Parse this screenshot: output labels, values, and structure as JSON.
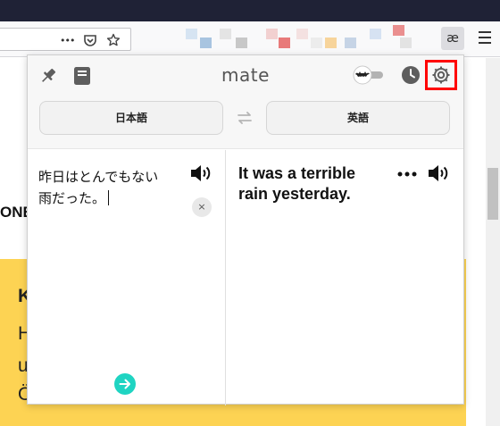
{
  "browser": {
    "more_glyph": "•••",
    "extension_label": "æ"
  },
  "background_page": {
    "bold_fragment": "ONE",
    "yellow_letters": [
      "K",
      "H",
      "u",
      "Ö"
    ],
    "yellow_color": "#fdd353"
  },
  "popup": {
    "brand": "mate",
    "icons": [
      "pin-icon",
      "phrasebook-icon",
      "bat-toggle-icon",
      "history-icon",
      "settings-icon"
    ],
    "source_lang": "日本語",
    "target_lang": "英語",
    "source_text_line1": "昨日はとんでもない",
    "source_text_line2": "雨だった。",
    "clear_glyph": "×",
    "translation_line1": "It was a terrible",
    "translation_line2": "rain yesterday.",
    "accent_color": "#1fd4c2",
    "highlight_color": "#ff0000"
  }
}
